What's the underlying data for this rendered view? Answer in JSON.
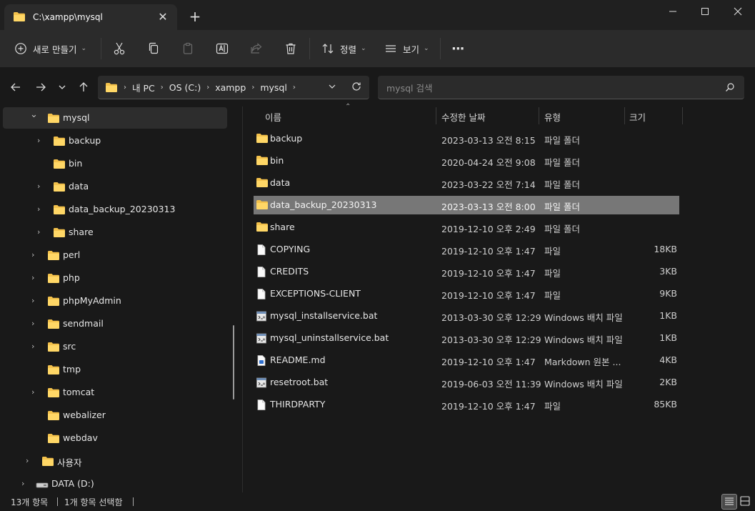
{
  "window": {
    "tab_title": "C:\\xampp\\mysql",
    "tab_close": "✕",
    "new_tab": "+",
    "minimize": "—",
    "maximize": "☐",
    "close": "✕"
  },
  "toolbar": {
    "new_label": "새로 만들기",
    "sort_label": "정렬",
    "view_label": "보기",
    "more_label": "···"
  },
  "address": {
    "crumbs": [
      "내 PC",
      "OS (C:)",
      "xampp",
      "mysql"
    ],
    "search_placeholder": "mysql 검색"
  },
  "tree": [
    {
      "label": "mysql",
      "expanded": true,
      "selected": true
    },
    {
      "label": "backup"
    },
    {
      "label": "bin"
    },
    {
      "label": "data"
    },
    {
      "label": "data_backup_20230313"
    },
    {
      "label": "share"
    },
    {
      "label": "perl"
    },
    {
      "label": "php"
    },
    {
      "label": "phpMyAdmin"
    },
    {
      "label": "sendmail"
    },
    {
      "label": "src"
    },
    {
      "label": "tmp"
    },
    {
      "label": "tomcat"
    },
    {
      "label": "webalizer"
    },
    {
      "label": "webdav"
    },
    {
      "label": "사용자"
    },
    {
      "label": "DATA (D:)"
    }
  ],
  "columns": {
    "name": "이름",
    "date": "수정한 날짜",
    "type": "유형",
    "size": "크기"
  },
  "files": [
    {
      "name": "backup",
      "date": "2023-03-13 오전 8:15",
      "type": "파일 폴더",
      "size": "",
      "icon": "folder-icon"
    },
    {
      "name": "bin",
      "date": "2020-04-24 오전 9:08",
      "type": "파일 폴더",
      "size": "",
      "icon": "folder-icon"
    },
    {
      "name": "data",
      "date": "2023-03-22 오전 7:14",
      "type": "파일 폴더",
      "size": "",
      "icon": "folder-icon"
    },
    {
      "name": "data_backup_20230313",
      "date": "2023-03-13 오전 8:00",
      "type": "파일 폴더",
      "size": "",
      "icon": "folder-icon",
      "selected": true
    },
    {
      "name": "share",
      "date": "2019-12-10 오후 2:49",
      "type": "파일 폴더",
      "size": "",
      "icon": "folder-icon"
    },
    {
      "name": "COPYING",
      "date": "2019-12-10 오후 1:47",
      "type": "파일",
      "size": "18KB",
      "icon": "file-icon"
    },
    {
      "name": "CREDITS",
      "date": "2019-12-10 오후 1:47",
      "type": "파일",
      "size": "3KB",
      "icon": "file-icon"
    },
    {
      "name": "EXCEPTIONS-CLIENT",
      "date": "2019-12-10 오후 1:47",
      "type": "파일",
      "size": "9KB",
      "icon": "file-icon"
    },
    {
      "name": "mysql_installservice.bat",
      "date": "2013-03-30 오후 12:29",
      "type": "Windows 배치 파일",
      "size": "1KB",
      "icon": "batch-file-icon"
    },
    {
      "name": "mysql_uninstallservice.bat",
      "date": "2013-03-30 오후 12:29",
      "type": "Windows 배치 파일",
      "size": "1KB",
      "icon": "batch-file-icon"
    },
    {
      "name": "README.md",
      "date": "2019-12-10 오후 1:47",
      "type": "Markdown 원본 ...",
      "size": "4KB",
      "icon": "markdown-file-icon"
    },
    {
      "name": "resetroot.bat",
      "date": "2019-06-03 오전 11:39",
      "type": "Windows 배치 파일",
      "size": "2KB",
      "icon": "batch-file-icon"
    },
    {
      "name": "THIRDPARTY",
      "date": "2019-12-10 오후 1:47",
      "type": "파일",
      "size": "85KB",
      "icon": "file-icon"
    }
  ],
  "status": {
    "items_count": "13개 항목",
    "selected_count": "1개 항목 선택함"
  },
  "colors": {
    "folder": "#f3c14b",
    "selection": "#777777",
    "background": "#191919",
    "toolbar": "#2b2b2b"
  }
}
